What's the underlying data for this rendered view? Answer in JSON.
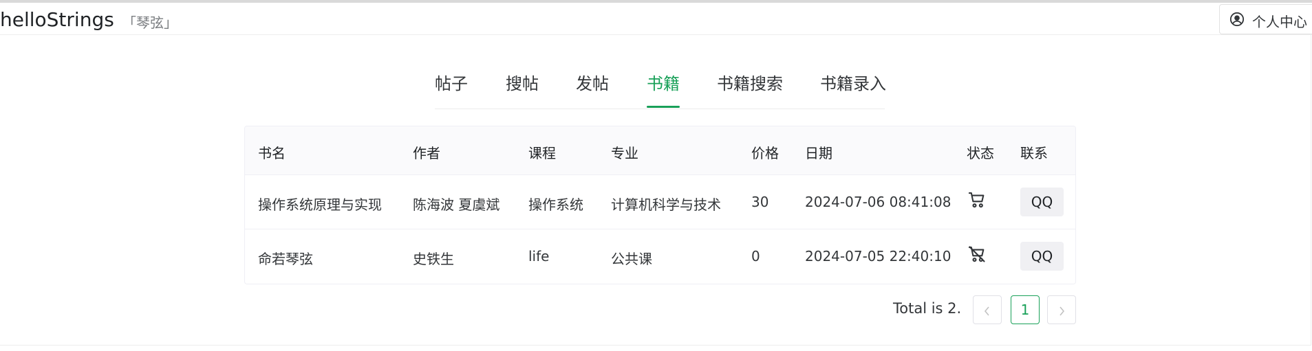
{
  "header": {
    "brand": "helloStrings",
    "subtitle": "「琴弦」",
    "user_center_label": "个人中心",
    "user_icon": "user-circle-icon"
  },
  "tabs": [
    {
      "label": "帖子",
      "active": false
    },
    {
      "label": "搜帖",
      "active": false
    },
    {
      "label": "发帖",
      "active": false
    },
    {
      "label": "书籍",
      "active": true
    },
    {
      "label": "书籍搜索",
      "active": false
    },
    {
      "label": "书籍录入",
      "active": false
    }
  ],
  "table": {
    "columns": [
      "书名",
      "作者",
      "课程",
      "专业",
      "价格",
      "日期",
      "状态",
      "联系"
    ],
    "rows": [
      {
        "title": "操作系统原理与实现",
        "author": "陈海波 夏虞斌",
        "course": "操作系统",
        "major": "计算机科学与技术",
        "price": "30",
        "date": "2024-07-06 08:41:08",
        "status_icon": "cart-icon",
        "contact": "QQ"
      },
      {
        "title": "命若琴弦",
        "author": "史铁生",
        "course": "life",
        "major": "公共课",
        "price": "0",
        "date": "2024-07-05 22:40:10",
        "status_icon": "cart-off-icon",
        "contact": "QQ"
      }
    ]
  },
  "pagination": {
    "total_text": "Total is 2.",
    "current_page": "1"
  },
  "colors": {
    "accent": "#18a058",
    "text": "#333639"
  }
}
